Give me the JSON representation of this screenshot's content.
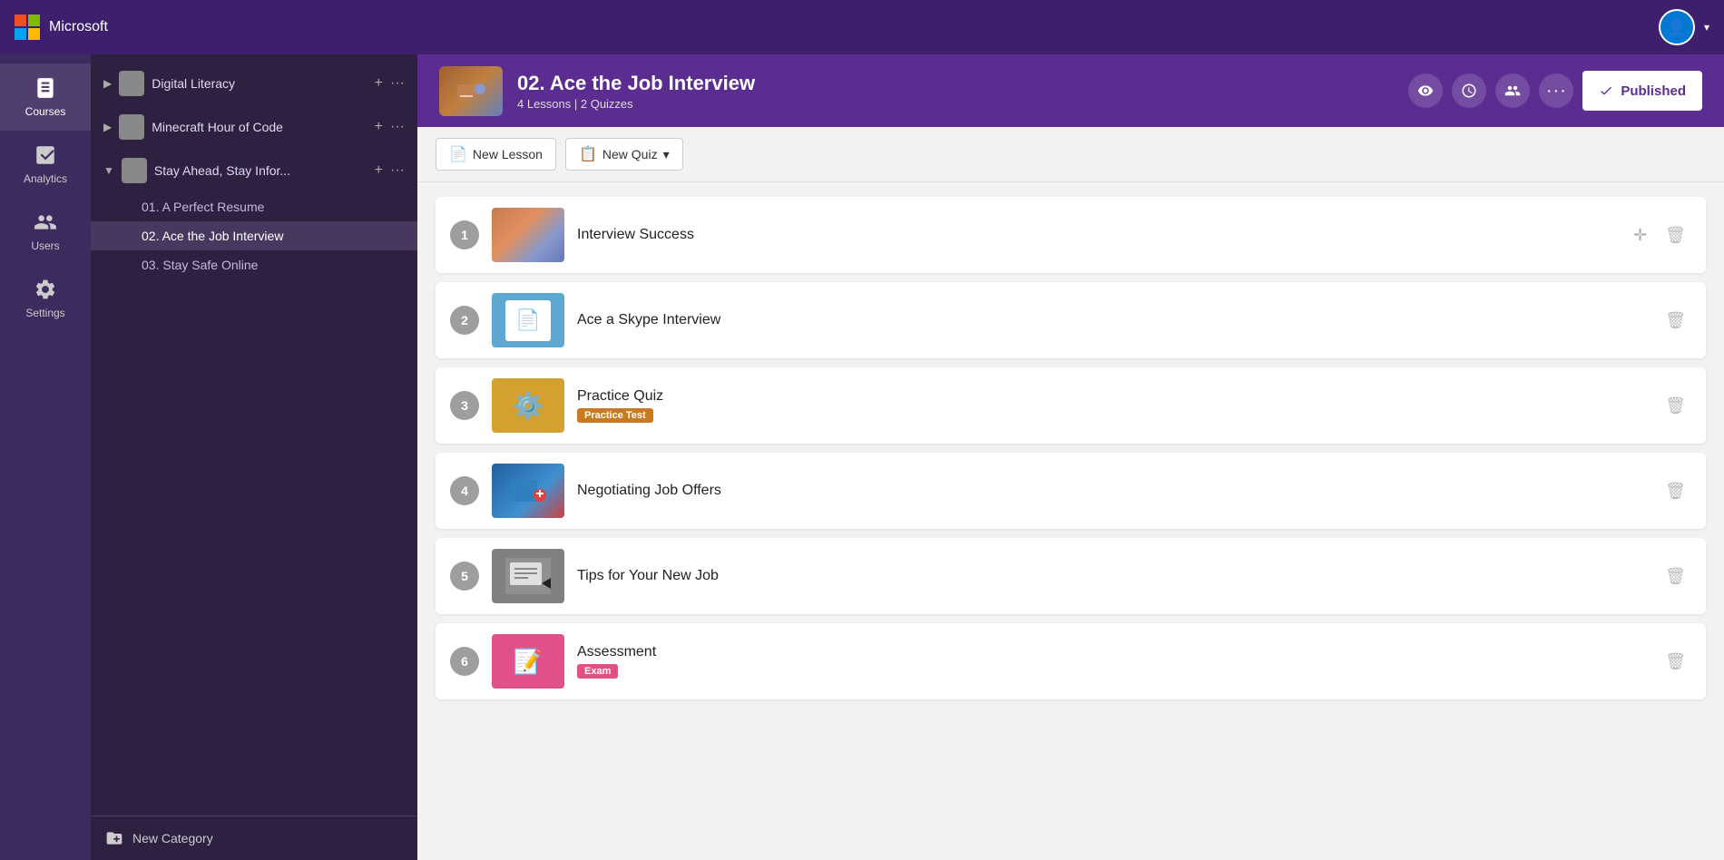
{
  "app": {
    "title": "Microsoft",
    "avatar_initial": "👤"
  },
  "nav": {
    "items": [
      {
        "id": "courses",
        "label": "Courses",
        "active": true
      },
      {
        "id": "analytics",
        "label": "Analytics",
        "active": false
      },
      {
        "id": "users",
        "label": "Users",
        "active": false
      },
      {
        "id": "settings",
        "label": "Settings",
        "active": false
      }
    ]
  },
  "sidebar": {
    "courses": [
      {
        "id": "digital-literacy",
        "name": "Digital Literacy",
        "expanded": false,
        "color_class": "ci-digital",
        "sub_items": []
      },
      {
        "id": "minecraft",
        "name": "Minecraft Hour of Code",
        "expanded": false,
        "color_class": "ci-minecraft",
        "sub_items": []
      },
      {
        "id": "stay-ahead",
        "name": "Stay Ahead, Stay Infor...",
        "expanded": true,
        "color_class": "ci-stayahead",
        "sub_items": [
          {
            "id": "lesson-01",
            "name": "01. A Perfect Resume",
            "active": false
          },
          {
            "id": "lesson-02",
            "name": "02. Ace the Job Interview",
            "active": true
          },
          {
            "id": "lesson-03",
            "name": "03. Stay Safe Online",
            "active": false
          }
        ]
      }
    ],
    "new_category_label": "New Category"
  },
  "course_header": {
    "title": "02. Ace the Job Interview",
    "meta": "4 Lessons | 2 Quizzes",
    "published_label": "Published",
    "action_icons": [
      "eye",
      "clock",
      "user-group",
      "more"
    ]
  },
  "toolbar": {
    "new_lesson_label": "New Lesson",
    "new_quiz_label": "New Quiz",
    "quiz_caret": "▾"
  },
  "items": [
    {
      "number": "1",
      "name": "Interview Success",
      "type": "lesson",
      "thumb_class": "item-thumb-1",
      "badge": null
    },
    {
      "number": "2",
      "name": "Ace a Skype Interview",
      "type": "lesson",
      "thumb_class": "item-thumb-2",
      "badge": null
    },
    {
      "number": "3",
      "name": "Practice Quiz",
      "type": "quiz",
      "thumb_class": "item-thumb-3",
      "badge": "Practice Test",
      "badge_class": "badge-practice"
    },
    {
      "number": "4",
      "name": "Negotiating Job Offers",
      "type": "lesson",
      "thumb_class": "item-thumb-4",
      "badge": null
    },
    {
      "number": "5",
      "name": "Tips for Your New Job",
      "type": "lesson",
      "thumb_class": "item-thumb-5",
      "badge": null
    },
    {
      "number": "6",
      "name": "Assessment",
      "type": "quiz",
      "thumb_class": "item-thumb-6",
      "badge": "Exam",
      "badge_class": "badge-exam"
    }
  ]
}
